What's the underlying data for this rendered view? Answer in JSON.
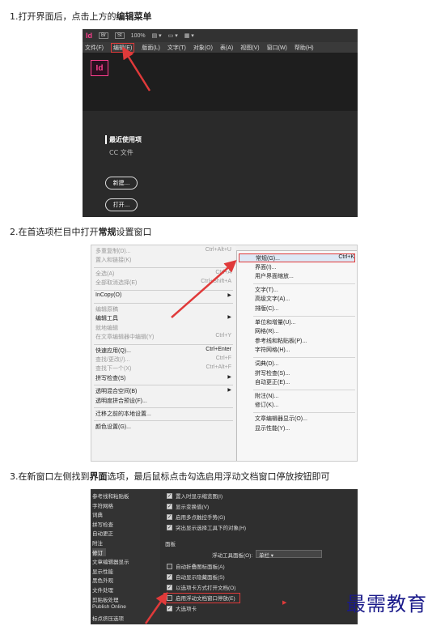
{
  "steps": [
    {
      "text_prefix": "1.打开界面后，点击上方的",
      "bold": "编辑菜单",
      "text_suffix": ""
    },
    {
      "text_prefix": "2.在首选项栏目中打开",
      "bold": "常规",
      "text_suffix": "设置窗口"
    },
    {
      "text_prefix": "3.在新窗口左侧找到",
      "bold": "界面",
      "text_suffix": "选项，最后鼠标点击勾选启用浮动文档窗口停放按钮即可"
    }
  ],
  "shot1": {
    "app_logo": "Id",
    "toolbar_items": [
      "Br",
      "St",
      "100%"
    ],
    "menubar": [
      "文件(F)",
      "编辑(E)",
      "版面(L)",
      "文字(T)",
      "对象(O)",
      "表(A)",
      "视图(V)",
      "窗口(W)",
      "帮助(H)"
    ],
    "home_logo": "Id",
    "recent_label": "最近使用项",
    "cc_label": "CC 文件",
    "new_button": "新建...",
    "open_button": "打开..."
  },
  "shot2": {
    "left_menu": [
      {
        "label": "多重复制(D)...",
        "shortcut": "Ctrl+Alt+U",
        "disabled": true
      },
      {
        "label": "置入和链接(K)",
        "shortcut": "",
        "disabled": true
      },
      {
        "sep": true
      },
      {
        "label": "全选(A)",
        "shortcut": "Ctrl+A",
        "disabled": true
      },
      {
        "label": "全部取消选择(E)",
        "shortcut": "Ctrl+Shift+A",
        "disabled": true
      },
      {
        "sep": true
      },
      {
        "label": "InCopy(O)",
        "shortcut": "",
        "submenu": true
      },
      {
        "sep": true
      },
      {
        "label": "编辑原稿",
        "shortcut": "",
        "disabled": true
      },
      {
        "label": "编辑工具",
        "shortcut": "",
        "submenu": true
      },
      {
        "label": "就地编辑",
        "shortcut": "",
        "disabled": true
      },
      {
        "label": "在文章编辑器中编辑(Y)",
        "shortcut": "Ctrl+Y",
        "disabled": true
      },
      {
        "sep": true
      },
      {
        "label": "快速应用(Q)...",
        "shortcut": "Ctrl+Enter"
      },
      {
        "label": "查找/更改(/)...",
        "shortcut": "Ctrl+F",
        "disabled": true
      },
      {
        "label": "查找下一个(X)",
        "shortcut": "Ctrl+Alt+F",
        "disabled": true
      },
      {
        "label": "拼写检查(S)",
        "shortcut": "",
        "submenu": true
      },
      {
        "sep": true
      },
      {
        "label": "透明混合空间(B)",
        "shortcut": "",
        "submenu": true
      },
      {
        "label": "透明度拼合预设(F)...",
        "shortcut": ""
      },
      {
        "sep": true
      },
      {
        "label": "迁移之前的本地设置...",
        "shortcut": ""
      },
      {
        "sep": true
      },
      {
        "label": "颜色设置(G)...",
        "shortcut": ""
      }
    ],
    "right_menu": [
      {
        "label": "常规(G)...",
        "shortcut": "Ctrl+K",
        "selected": true
      },
      {
        "label": "界面(I)...",
        "shortcut": ""
      },
      {
        "label": "用户界面缩放...",
        "shortcut": ""
      },
      {
        "sep": true
      },
      {
        "label": "文字(T)...",
        "shortcut": ""
      },
      {
        "label": "高级文字(A)...",
        "shortcut": ""
      },
      {
        "label": "排版(C)...",
        "shortcut": ""
      },
      {
        "sep": true
      },
      {
        "label": "单位和增量(U)...",
        "shortcut": ""
      },
      {
        "label": "网格(R)...",
        "shortcut": ""
      },
      {
        "label": "参考线和粘贴板(P)...",
        "shortcut": ""
      },
      {
        "label": "字符网格(H)...",
        "shortcut": ""
      },
      {
        "sep": true
      },
      {
        "label": "词典(D)...",
        "shortcut": ""
      },
      {
        "label": "拼写检查(S)...",
        "shortcut": ""
      },
      {
        "label": "自动更正(E)...",
        "shortcut": ""
      },
      {
        "sep": true
      },
      {
        "label": "附注(N)...",
        "shortcut": ""
      },
      {
        "label": "修订(K)...",
        "shortcut": ""
      },
      {
        "sep": true
      },
      {
        "label": "文章编辑器显示(O)...",
        "shortcut": ""
      },
      {
        "label": "显示性能(Y)...",
        "shortcut": ""
      }
    ]
  },
  "shot3": {
    "sidebar": [
      "参考线和粘贴板",
      "字符网格",
      "词典",
      "拼写检查",
      "自动更正",
      "附注",
      "修订",
      "文章编辑器显示",
      "显示性能",
      "黑色外观",
      "文件处理",
      "剪贴板处理",
      "Publish Online",
      "标点挤压选项"
    ],
    "selected_sidebar_index": 6,
    "top_checks": [
      {
        "label": "置入时显示缩览图(I)",
        "checked": true
      },
      {
        "label": "显示变换值(V)",
        "checked": true
      },
      {
        "label": "启用多点触控手势(G)",
        "checked": true
      },
      {
        "label": "突出显示选择工具下的对象(H)",
        "checked": true
      }
    ],
    "panel_group": "面板",
    "floating_tool_panel_label": "浮动工具面板(O):",
    "floating_tool_panel_value": "单栏",
    "bottom_checks": [
      {
        "label": "自动折叠图标面板(A)",
        "checked": false
      },
      {
        "label": "自动显示隐藏面板(S)",
        "checked": true
      },
      {
        "label": "以选项卡方式打开文档(O)",
        "checked": true
      },
      {
        "label": "启用浮动文档窗口停放(E)",
        "checked": false
      },
      {
        "label": "大选项卡",
        "checked": true
      }
    ]
  },
  "watermark": "最需教育",
  "colors": {
    "highlight": "#e03a3a",
    "indesign_pink": "#ff3f8e",
    "watermark": "#1a1a8a"
  }
}
